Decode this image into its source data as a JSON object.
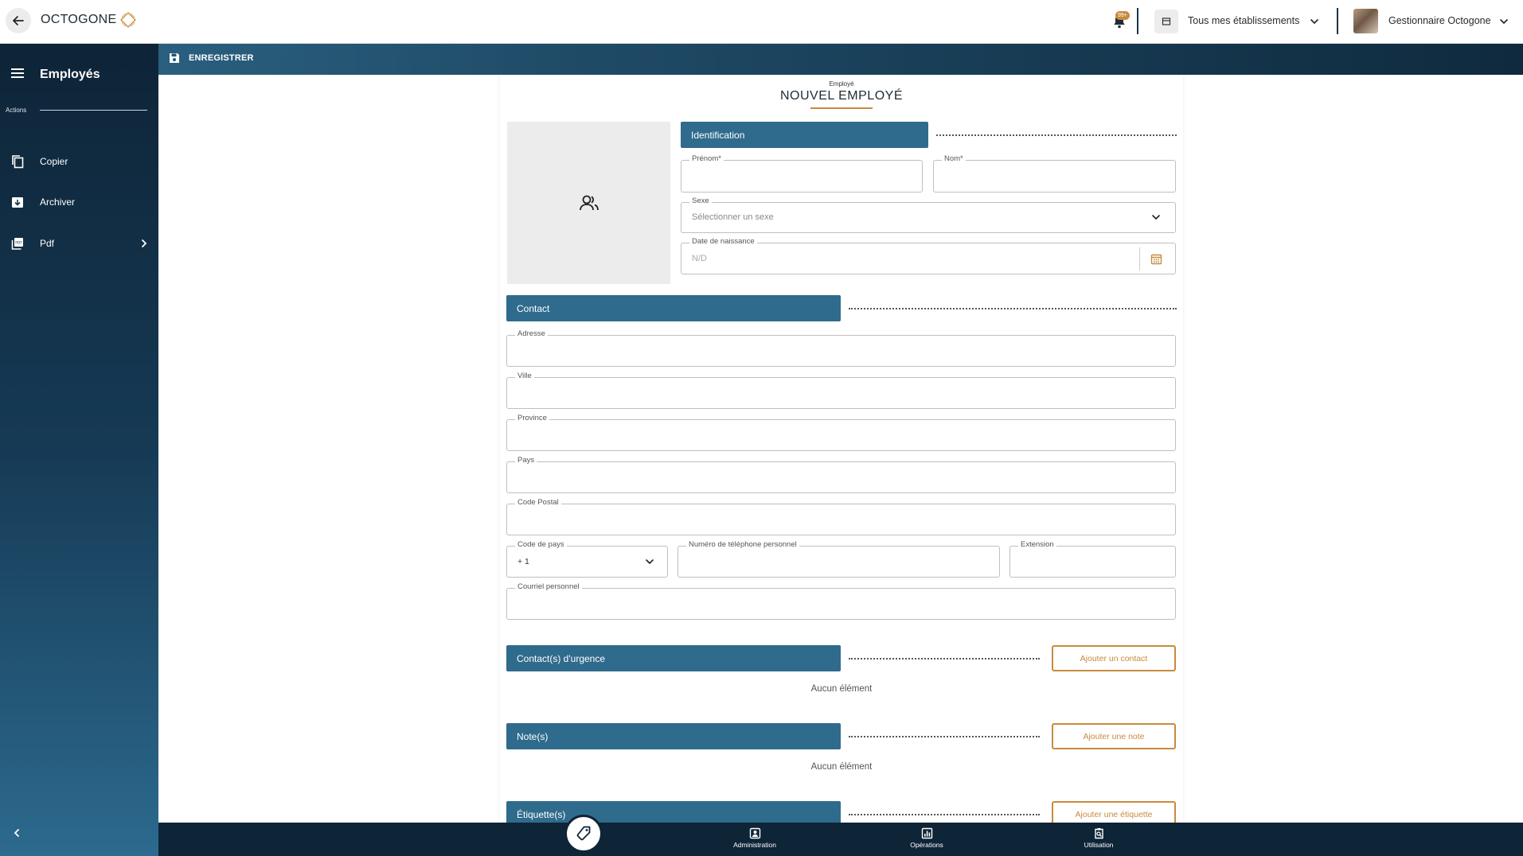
{
  "topbar": {
    "logo_text": "OCTOGONE",
    "notification_badge": "99+",
    "establishment_label": "Tous mes établissements",
    "user_label": "Gestionnaire Octogone"
  },
  "sidebar": {
    "title": "Employés",
    "actions_label": "Actions",
    "items": [
      {
        "label": "Copier",
        "icon": "copy-icon"
      },
      {
        "label": "Archiver",
        "icon": "archive-icon"
      },
      {
        "label": "Pdf",
        "icon": "pdf-icon"
      }
    ]
  },
  "toolbar": {
    "save_label": "ENREGISTRER"
  },
  "form": {
    "kicker": "Employé",
    "title": "NOUVEL EMPLOYÉ",
    "sections": {
      "identification": "Identification",
      "contact": "Contact",
      "emergency": "Contact(s) d'urgence",
      "notes": "Note(s)",
      "tags": "Étiquette(s)"
    },
    "fields": {
      "first_name": {
        "label": "Prénom*",
        "value": ""
      },
      "last_name": {
        "label": "Nom*",
        "value": ""
      },
      "sex": {
        "label": "Sexe",
        "placeholder": "Sélectionner un sexe"
      },
      "birth_date": {
        "label": "Date de naissance",
        "placeholder": "N/D"
      },
      "address": {
        "label": "Adresse",
        "value": ""
      },
      "city": {
        "label": "Ville",
        "value": ""
      },
      "province": {
        "label": "Province",
        "value": ""
      },
      "country": {
        "label": "Pays",
        "value": ""
      },
      "postal_code": {
        "label": "Code Postal",
        "value": ""
      },
      "country_code": {
        "label": "Code de pays",
        "value": "+ 1"
      },
      "phone": {
        "label": "Numéro de téléphone personnel",
        "value": ""
      },
      "extension": {
        "label": "Extension",
        "value": ""
      },
      "email": {
        "label": "Courriel personnel",
        "value": ""
      }
    },
    "buttons": {
      "add_contact": "Ajouter un contact",
      "add_note": "Ajouter une note",
      "add_tag": "Ajouter une étiquette"
    },
    "empty_text": "Aucun élément"
  },
  "bottom_nav": {
    "items": [
      {
        "label": "Administration",
        "icon": "badge-icon"
      },
      {
        "label": "Opérations",
        "icon": "chart-icon"
      },
      {
        "label": "Utilisation",
        "icon": "clipboard-search-icon"
      }
    ]
  },
  "colors": {
    "primary": "#2f6b8c",
    "navy": "#0e2437",
    "accent": "#c98a3c"
  }
}
